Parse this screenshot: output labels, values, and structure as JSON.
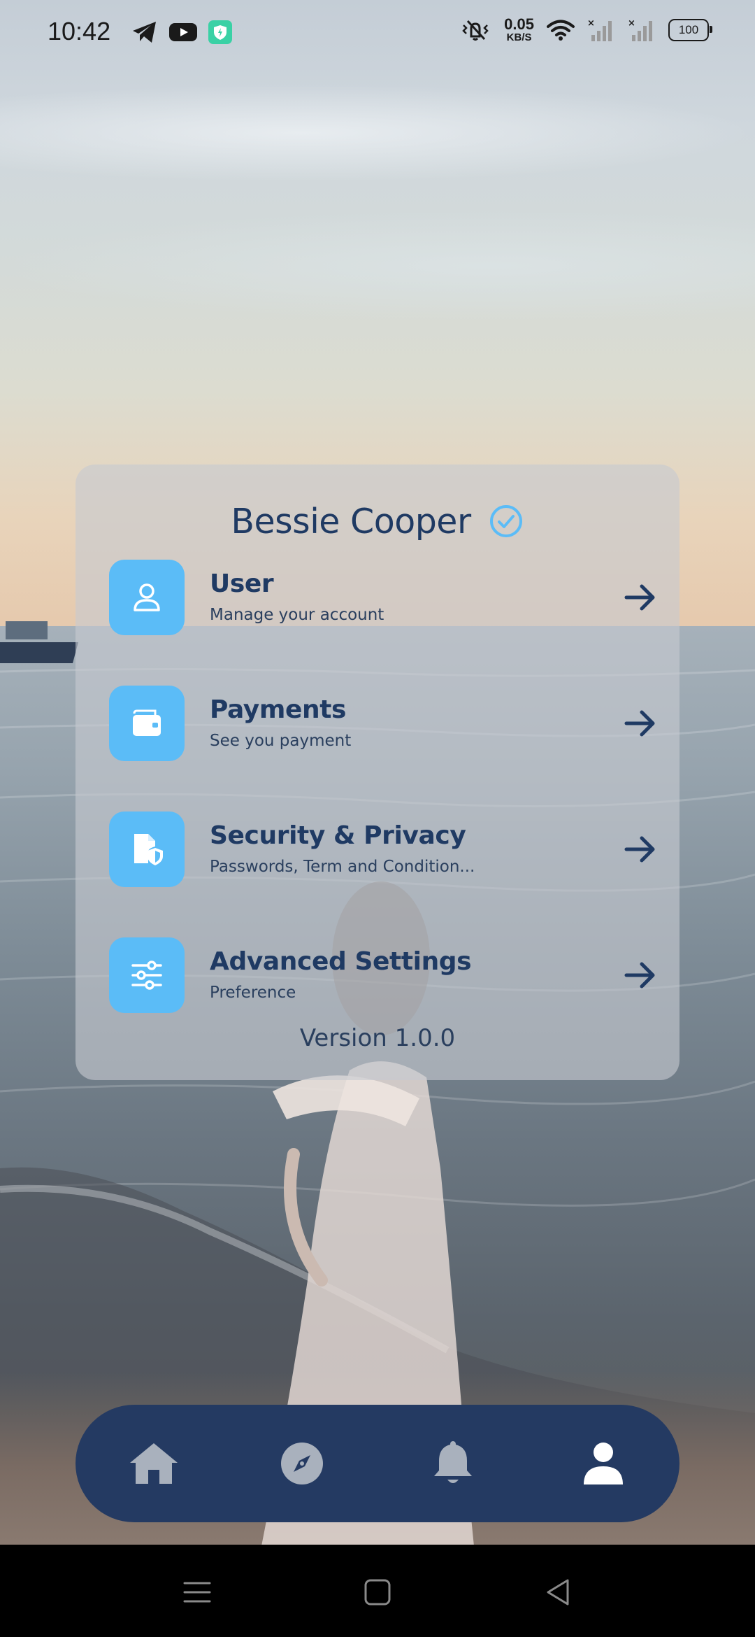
{
  "status_bar": {
    "time": "10:42",
    "net_speed_value": "0.05",
    "net_speed_unit": "KB/S",
    "battery": "100",
    "left_icons": [
      "telegram-icon",
      "youtube-icon",
      "vpn-shield-icon"
    ],
    "right_icons": [
      "vibrate-off-icon",
      "wifi-icon",
      "signal-icon",
      "signal-icon"
    ]
  },
  "profile": {
    "name": "Bessie Cooper",
    "verified_icon": "check-circle-icon"
  },
  "menu": [
    {
      "title": "User",
      "subtitle": "Manage your account",
      "icon": "user-icon"
    },
    {
      "title": "Payments",
      "subtitle": "See you payment",
      "icon": "wallet-icon"
    },
    {
      "title": "Security & Privacy",
      "subtitle": "Passwords, Term and Condition...",
      "icon": "document-shield-icon"
    },
    {
      "title": "Advanced Settings",
      "subtitle": "Preference",
      "icon": "sliders-icon"
    }
  ],
  "version": "Version 1.0.0",
  "bottom_nav": {
    "items": [
      "home-icon",
      "compass-icon",
      "bell-icon",
      "profile-icon"
    ],
    "active": "profile-icon"
  },
  "colors": {
    "accent": "#5bbcf7",
    "text_dark": "#1f3a63",
    "nav_bg": "#243a62",
    "nav_inactive": "#a9b1bd",
    "nav_active": "#ffffff"
  }
}
